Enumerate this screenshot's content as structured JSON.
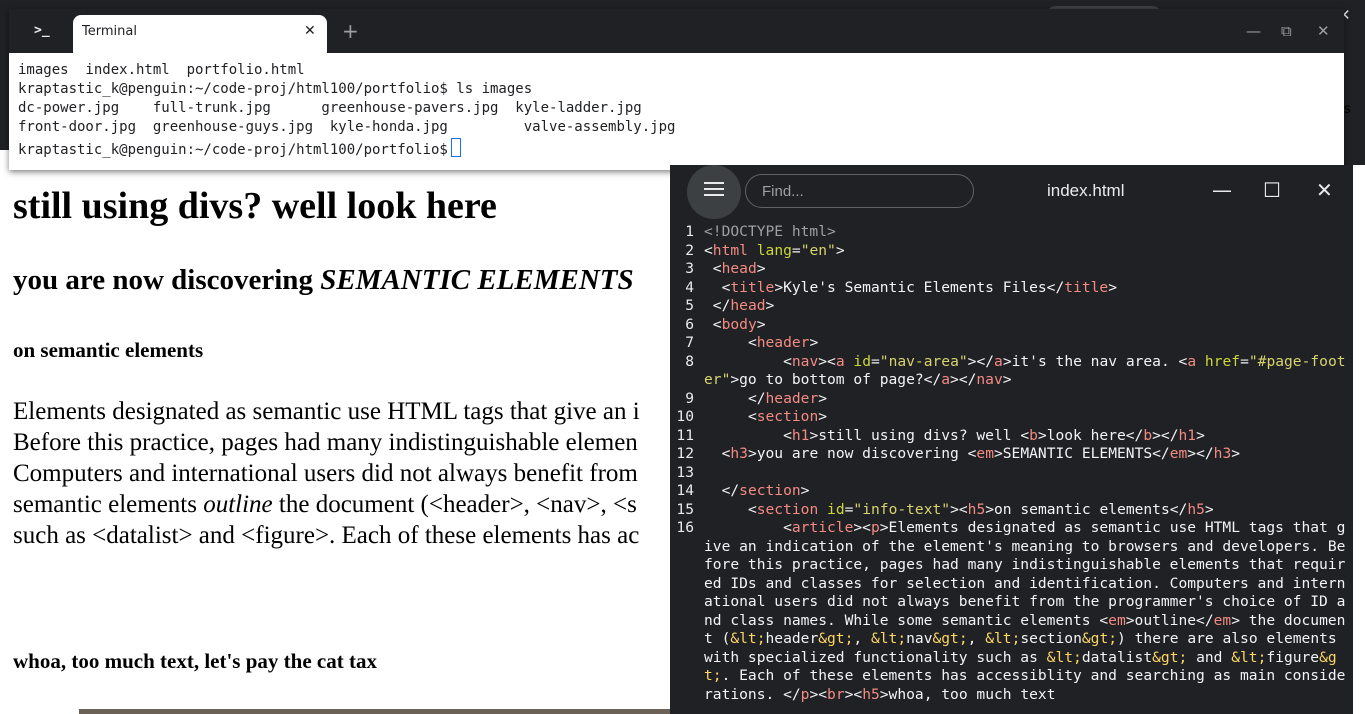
{
  "terminal": {
    "tab_title": "Terminal",
    "app_icon": ">_",
    "close_glyph": "✕",
    "new_tab_glyph": "+",
    "minimize_glyph": "—",
    "maximize_glyph": "⧉",
    "window_close_glyph": "✕",
    "lines": [
      "images  index.html  portfolio.html",
      "kraptastic_k@penguin:~/code-proj/html100/portfolio$ ls images",
      "dc-power.jpg    full-trunk.jpg      greenhouse-pavers.jpg  kyle-ladder.jpg",
      "front-door.jpg  greenhouse-guys.jpg  kyle-honda.jpg         valve-assembly.jpg",
      "kraptastic_k@penguin:~/code-proj/html100/portfolio$"
    ]
  },
  "background": {
    "close_glyph": "✕",
    "edge_text": "s"
  },
  "page": {
    "h1": "still using divs? well look here",
    "h3_prefix": "you are now discovering ",
    "h3_em": "SEMANTIC ELEMENTS",
    "h5_a": "on semantic elements",
    "para_lines": [
      "Elements designated as semantic use HTML tags that give an i",
      "Before this practice, pages had many indistinguishable elemen",
      "Computers and international users did not always benefit from",
      "semantic elements ",
      "such as <datalist> and <figure>. Each of these elements has ac"
    ],
    "para_outline_em": "outline",
    "para_line4_rest": " the document (<header>, <nav>, <s",
    "h5_b": "whoa, too much text, let's pay the cat tax"
  },
  "editor": {
    "find_placeholder": "Find...",
    "filename": "index.html",
    "minimize_glyph": "—",
    "maximize_glyph": "☐",
    "close_glyph": "✕",
    "line_numbers": [
      "1",
      "2",
      "3",
      "4",
      "5",
      "6",
      "7",
      "8",
      "9",
      "10",
      "11",
      "12",
      "13",
      "14",
      "15",
      "16"
    ]
  }
}
